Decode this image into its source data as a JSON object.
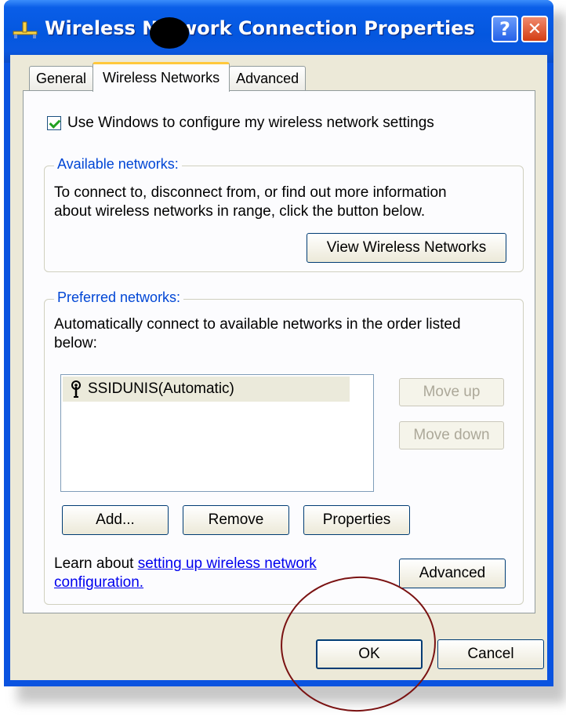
{
  "window": {
    "title": "Wireless Network Connection Properties"
  },
  "titlebar_buttons": {
    "help": "?",
    "close": "✕"
  },
  "tabs": [
    {
      "label": "General",
      "active": false
    },
    {
      "label": "Wireless Networks",
      "active": true
    },
    {
      "label": "Advanced",
      "active": false
    }
  ],
  "use_windows_checkbox": {
    "label": "Use Windows to configure my wireless network settings",
    "checked": true
  },
  "available": {
    "legend": "Available networks:",
    "description_line1": "To connect to, disconnect from, or find out more information",
    "description_line2": "about wireless networks in range, click the button below.",
    "view_button": "View Wireless Networks"
  },
  "preferred": {
    "legend": "Preferred networks:",
    "description_line1": "Automatically connect to available networks in the order listed",
    "description_line2": "below:",
    "networks": [
      {
        "name": "SSIDUNIS(Automatic)",
        "icon": "wireless-antenna-icon"
      }
    ],
    "move_up": "Move up",
    "move_down": "Move down",
    "add": "Add...",
    "remove": "Remove",
    "properties": "Properties",
    "learn_prefix": "Learn about ",
    "learn_link_line1": "setting up wireless network",
    "learn_link_line2": "configuration.",
    "advanced": "Advanced"
  },
  "footer": {
    "ok": "OK",
    "cancel": "Cancel"
  },
  "colors": {
    "title_bar": "#0a5ee8",
    "dialog_bg": "#ece9d8",
    "legend_text": "#0046d5",
    "annotation_oval": "#7a1212"
  }
}
